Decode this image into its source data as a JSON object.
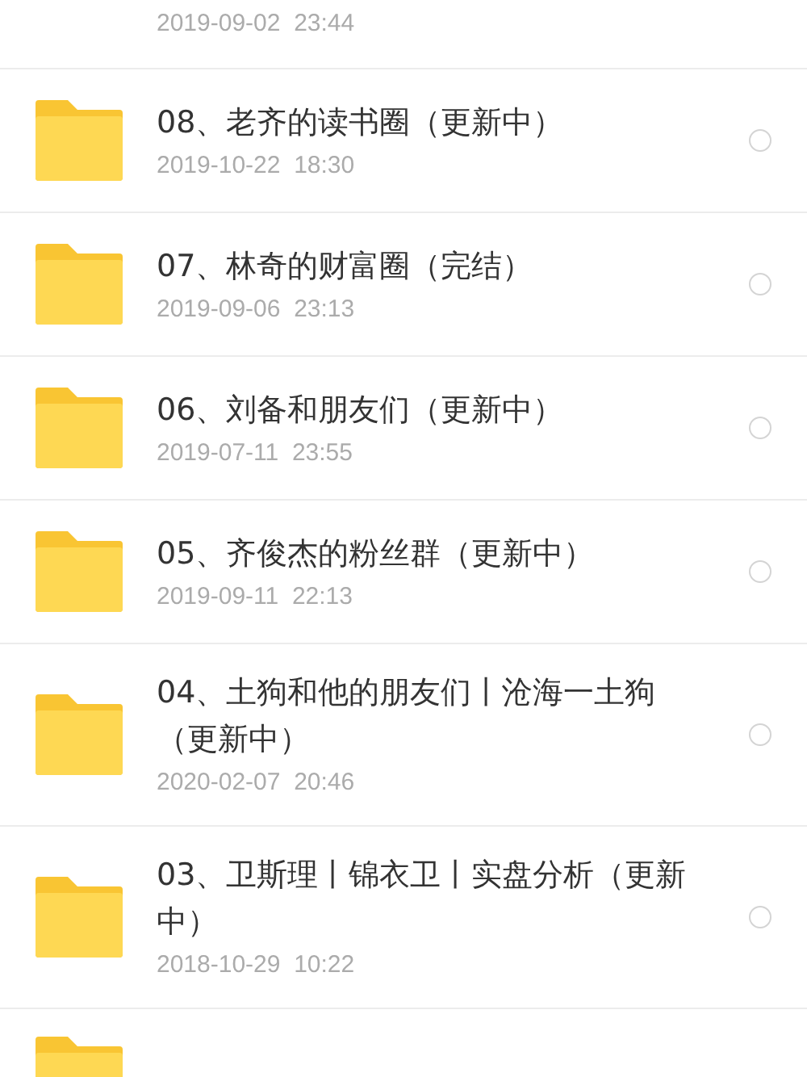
{
  "top_row": {
    "date": "2019-09-02",
    "time": "23:44"
  },
  "folders": [
    {
      "title": "08、老齐的读书圈（更新中）",
      "date": "2019-10-22",
      "time": "18:30",
      "selected": false
    },
    {
      "title": "07、林奇的财富圈（完结）",
      "date": "2019-09-06",
      "time": "23:13",
      "selected": false
    },
    {
      "title": "06、刘备和朋友们（更新中）",
      "date": "2019-07-11",
      "time": "23:55",
      "selected": false
    },
    {
      "title": "05、齐俊杰的粉丝群（更新中）",
      "date": "2019-09-11",
      "time": "22:13",
      "selected": false
    },
    {
      "title": "04、土狗和他的朋友们丨沧海一土狗（更新中）",
      "date": "2020-02-07",
      "time": "20:46",
      "selected": false
    },
    {
      "title": "03、卫斯理丨锦衣卫丨实盘分析（更新中）",
      "date": "2018-10-29",
      "time": "10:22",
      "selected": false
    }
  ],
  "cut_row": {
    "kind": "folder"
  }
}
